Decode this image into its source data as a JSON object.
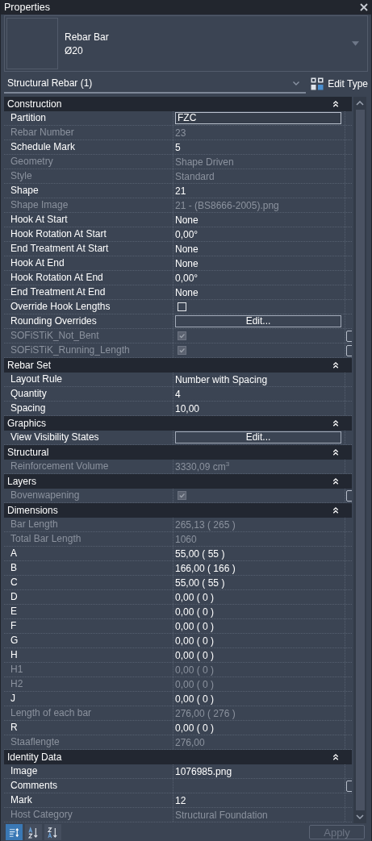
{
  "window": {
    "title": "Properties"
  },
  "type_selector": {
    "name_lines": [
      "Rebar Bar",
      "Ø20"
    ]
  },
  "instance_selector": {
    "label": "Structural Rebar (1)",
    "edit_type": "Edit Type"
  },
  "sections": [
    {
      "title": "Construction",
      "expanded": true,
      "rows": [
        {
          "label": "Partition",
          "kind": "field",
          "value": "FZC",
          "disabled": false
        },
        {
          "label": "Rebar Number",
          "kind": "text",
          "value": "23",
          "disabled": true
        },
        {
          "label": "Schedule Mark",
          "kind": "text",
          "value": "5",
          "disabled": false
        },
        {
          "label": "Geometry",
          "kind": "text",
          "value": "Shape Driven",
          "disabled": true
        },
        {
          "label": "Style",
          "kind": "text",
          "value": "Standard",
          "disabled": true
        },
        {
          "label": "Shape",
          "kind": "text",
          "value": "21",
          "disabled": false
        },
        {
          "label": "Shape Image",
          "kind": "text",
          "value": "21 - (BS8666-2005).png",
          "disabled": true
        },
        {
          "label": "Hook At Start",
          "kind": "text",
          "value": "None",
          "disabled": false
        },
        {
          "label": "Hook Rotation At Start",
          "kind": "text",
          "value": "0,00°",
          "disabled": false
        },
        {
          "label": "End Treatment At Start",
          "kind": "text",
          "value": "None",
          "disabled": false
        },
        {
          "label": "Hook At End",
          "kind": "text",
          "value": "None",
          "disabled": false
        },
        {
          "label": "Hook Rotation At End",
          "kind": "text",
          "value": "0,00°",
          "disabled": false
        },
        {
          "label": "End Treatment At End",
          "kind": "text",
          "value": "None",
          "disabled": false
        },
        {
          "label": "Override Hook Lengths",
          "kind": "checkbox",
          "checked": false,
          "disabled": false
        },
        {
          "label": "Rounding Overrides",
          "kind": "button",
          "value": "Edit...",
          "disabled": false
        },
        {
          "label": "SOFiSTiK_Not_Bent",
          "kind": "checkbox",
          "checked": true,
          "disabled": true,
          "side_box": true
        },
        {
          "label": "SOFiSTiK_Running_Length",
          "kind": "checkbox",
          "checked": true,
          "disabled": true,
          "side_box": true
        }
      ]
    },
    {
      "title": "Rebar Set",
      "expanded": true,
      "rows": [
        {
          "label": "Layout Rule",
          "kind": "text",
          "value": "Number with Spacing",
          "disabled": false
        },
        {
          "label": "Quantity",
          "kind": "text",
          "value": "4",
          "disabled": false
        },
        {
          "label": "Spacing",
          "kind": "text",
          "value": "10,00",
          "disabled": false
        }
      ]
    },
    {
      "title": "Graphics",
      "expanded": true,
      "rows": [
        {
          "label": "View Visibility States",
          "kind": "button",
          "value": "Edit...",
          "disabled": false
        }
      ]
    },
    {
      "title": "Structural",
      "expanded": true,
      "rows": [
        {
          "label": "Reinforcement Volume",
          "kind": "text",
          "value": "3330,09 cm$^{3}$",
          "disabled": true
        }
      ]
    },
    {
      "title": "Layers",
      "expanded": true,
      "rows": [
        {
          "label": "Bovenwapening",
          "kind": "checkbox",
          "checked": true,
          "disabled": true,
          "side_box": true
        }
      ]
    },
    {
      "title": "Dimensions",
      "expanded": true,
      "rows": [
        {
          "label": "Bar Length",
          "kind": "text",
          "value": "265,13 ( 265 )",
          "disabled": true
        },
        {
          "label": "Total Bar Length",
          "kind": "text",
          "value": "1060",
          "disabled": true
        },
        {
          "label": "A",
          "kind": "text",
          "value": "55,00 ( 55 )",
          "disabled": false
        },
        {
          "label": "B",
          "kind": "text",
          "value": "166,00 ( 166 )",
          "disabled": false
        },
        {
          "label": "C",
          "kind": "text",
          "value": "55,00 ( 55 )",
          "disabled": false
        },
        {
          "label": "D",
          "kind": "text",
          "value": "0,00 ( 0 )",
          "disabled": false
        },
        {
          "label": "E",
          "kind": "text",
          "value": "0,00 ( 0 )",
          "disabled": false
        },
        {
          "label": "F",
          "kind": "text",
          "value": "0,00 ( 0 )",
          "disabled": false
        },
        {
          "label": "G",
          "kind": "text",
          "value": "0,00 ( 0 )",
          "disabled": false
        },
        {
          "label": "H",
          "kind": "text",
          "value": "0,00 ( 0 )",
          "disabled": false
        },
        {
          "label": "H1",
          "kind": "text",
          "value": "0,00 ( 0 )",
          "disabled": true
        },
        {
          "label": "H2",
          "kind": "text",
          "value": "0,00 ( 0 )",
          "disabled": true
        },
        {
          "label": "J",
          "kind": "text",
          "value": "0,00 ( 0 )",
          "disabled": false
        },
        {
          "label": "Length of each bar",
          "kind": "text",
          "value": "276,00 ( 276 )",
          "disabled": true
        },
        {
          "label": "R",
          "kind": "text",
          "value": "0,00 ( 0 )",
          "disabled": false
        },
        {
          "label": "Staaflengte",
          "kind": "text",
          "value": "276,00",
          "disabled": true
        }
      ]
    },
    {
      "title": "Identity Data",
      "expanded": true,
      "rows": [
        {
          "label": "Image",
          "kind": "text",
          "value": "1076985.png",
          "disabled": false
        },
        {
          "label": "Comments",
          "kind": "text",
          "disabled": false,
          "side_box": true
        },
        {
          "label": "Mark",
          "kind": "text",
          "value": "12",
          "disabled": false
        },
        {
          "label": "Host Category",
          "kind": "text",
          "value": "Structural Foundation",
          "disabled": true
        }
      ]
    }
  ],
  "footer": {
    "sort_buttons": [
      {
        "kind": "grouped",
        "selected": true
      },
      {
        "kind": "az",
        "selected": false
      },
      {
        "kind": "za",
        "selected": false
      }
    ],
    "apply": {
      "label": "Apply",
      "disabled": true
    }
  }
}
